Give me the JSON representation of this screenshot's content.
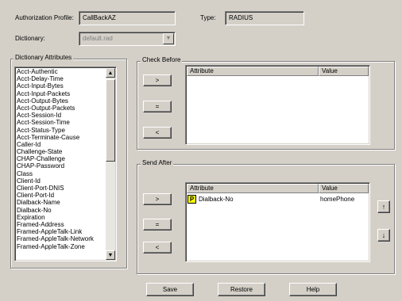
{
  "header": {
    "auth_profile_label": "Authorization Profile:",
    "auth_profile_value": "CallBackAZ",
    "type_label": "Type:",
    "type_value": "RADIUS",
    "dictionary_label": "Dictionary:",
    "dictionary_value": "default.rad"
  },
  "dictionary_attributes": {
    "title": "Dictionary Attributes",
    "items": [
      "Acct-Authentic",
      "Acct-Delay-Time",
      "Acct-Input-Bytes",
      "Acct-Input-Packets",
      "Acct-Output-Bytes",
      "Acct-Output-Packets",
      "Acct-Session-Id",
      "Acct-Session-Time",
      "Acct-Status-Type",
      "Acct-Terminate-Cause",
      "Caller-Id",
      "Challenge-State",
      "CHAP-Challenge",
      "CHAP-Password",
      "Class",
      "Client-Id",
      "Client-Port-DNIS",
      "Client-Port-Id",
      "Dialback-Name",
      "Dialback-No",
      "Expiration",
      "Framed-Address",
      "Framed-AppleTalk-Link",
      "Framed-AppleTalk-Network",
      "Framed-AppleTalk-Zone"
    ]
  },
  "check_before": {
    "title": "Check Before",
    "add_label": ">",
    "equals_label": "=",
    "remove_label": "<",
    "columns": [
      "Attribute",
      "Value"
    ],
    "rows": []
  },
  "send_after": {
    "title": "Send After",
    "add_label": ">",
    "equals_label": "=",
    "remove_label": "<",
    "columns": [
      "Attribute",
      "Value"
    ],
    "rows": [
      {
        "icon_letter": "P",
        "attribute": "Dialback-No",
        "value": "homePhone"
      }
    ],
    "move_up_label": "↑",
    "move_down_label": "↓"
  },
  "footer": {
    "save_label": "Save",
    "restore_label": "Restore",
    "help_label": "Help"
  },
  "colors": {
    "face": "#d4d0c8",
    "icon_bg": "#ffff00"
  }
}
